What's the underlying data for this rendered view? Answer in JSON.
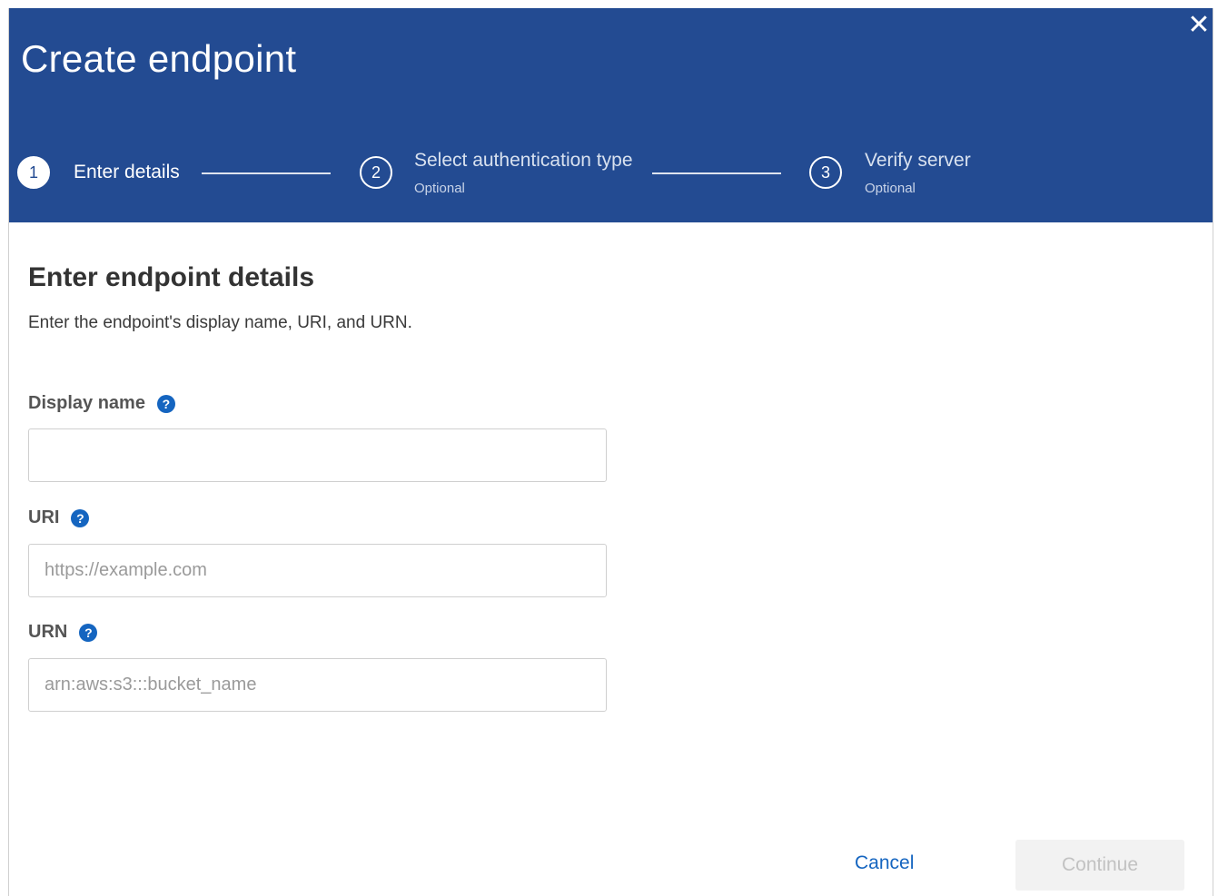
{
  "dialog": {
    "title": "Create endpoint",
    "close_label": "✕"
  },
  "steps": [
    {
      "number": "1",
      "label": "Enter details",
      "sublabel": "",
      "active": true
    },
    {
      "number": "2",
      "label": "Select authentication type",
      "sublabel": "Optional",
      "active": false
    },
    {
      "number": "3",
      "label": "Verify server",
      "sublabel": "Optional",
      "active": false
    }
  ],
  "section": {
    "title": "Enter endpoint details",
    "description": "Enter the endpoint's display name, URI, and URN."
  },
  "fields": {
    "display_name": {
      "label": "Display name",
      "value": "",
      "placeholder": "",
      "help_icon": "question-circle-icon"
    },
    "uri": {
      "label": "URI",
      "value": "",
      "placeholder": "https://example.com",
      "help_icon": "question-circle-icon"
    },
    "urn": {
      "label": "URN",
      "value": "",
      "placeholder": "arn:aws:s3:::bucket_name",
      "help_icon": "question-circle-icon"
    }
  },
  "footer": {
    "cancel_label": "Cancel",
    "continue_label": "Continue"
  },
  "colors": {
    "header_bg": "#234b92",
    "accent": "#1565c0",
    "disabled_bg": "#f2f2f2",
    "disabled_text": "#c2c2c2"
  }
}
